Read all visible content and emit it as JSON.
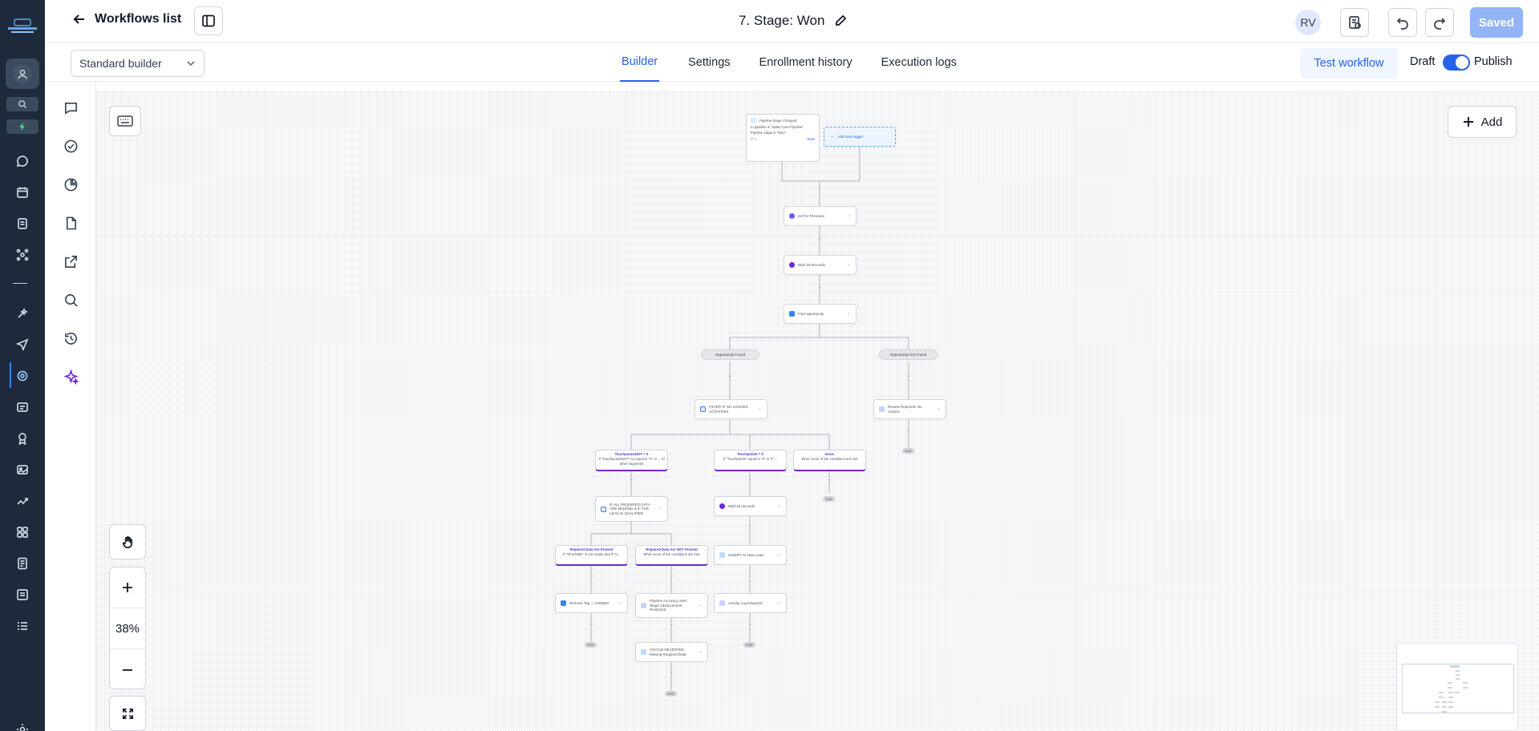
{
  "header": {
    "back_label": "Workflows list",
    "workflow_title": "7. Stage: Won",
    "avatar_initials": "RV",
    "saved_label": "Saved"
  },
  "subheader": {
    "builder_select": "Standard builder",
    "tabs": [
      {
        "label": "Builder",
        "active": true
      },
      {
        "label": "Settings",
        "active": false
      },
      {
        "label": "Enrollment history",
        "active": false
      },
      {
        "label": "Execution logs",
        "active": false
      }
    ],
    "test_workflow_label": "Test workflow",
    "draft_label": "Draft",
    "publish_label": "Publish",
    "publish_toggle_on": true
  },
  "canvas": {
    "add_label": "Add",
    "zoom_level": "38%",
    "trigger": {
      "title": "Pipeline Stage Changed",
      "line1": "In pipeline is \"Sales Core Pipeline\"",
      "line2": "Pipeline stage is \"Won\"",
      "stats_label": "Stats"
    },
    "add_trigger_label": "Add new trigger",
    "nodes": {
      "wait1": "22 Per Filename",
      "wait2": "Wait 15 Seconds",
      "find_opp": "Find opportunity",
      "opp_found": "Opportunity Found",
      "opp_not_found": "Opportunity Not Found",
      "filter": "FILTER IF NO LOGGED ACTIVITIES",
      "review": "Review Required: No Actions",
      "branch1_title": "TouchpointsNOT = 0",
      "branch1_text": "If \"TouchpointsNOT\" no equal to \"0\" or ... of other segments",
      "branch2_title": "Touchpoints = 0",
      "branch2_text": "If \"Touchpoints\" equal to \"0\" or if \"...",
      "branch3_title": "None",
      "branch3_text": "When none of the conditions are met",
      "all_required": "IF ALL REQUIRED DATA ARE MISSING & IF THE LEAD IS QUALIFIED",
      "wait3": "Wait 45 seconds",
      "req_present_title": "Required Data Are Present",
      "req_present_text": "If \"TimeTable\" is not empty and If \"S...",
      "req_missing_title": "Required Data Are NOT Present",
      "req_missing_text": "When none of the conditions are met",
      "insert_new_lead": "INSERT To New Lead",
      "remove_tag": "Remove Tag — OWNED",
      "pipeline_accuracy": "Pipeline Accuracy Alert: Stage Advancement Restricted",
      "activity_log": "Activity Log Required",
      "status_reverted": "STATUS REVERTED: Missing Required Data",
      "end": "END"
    }
  }
}
